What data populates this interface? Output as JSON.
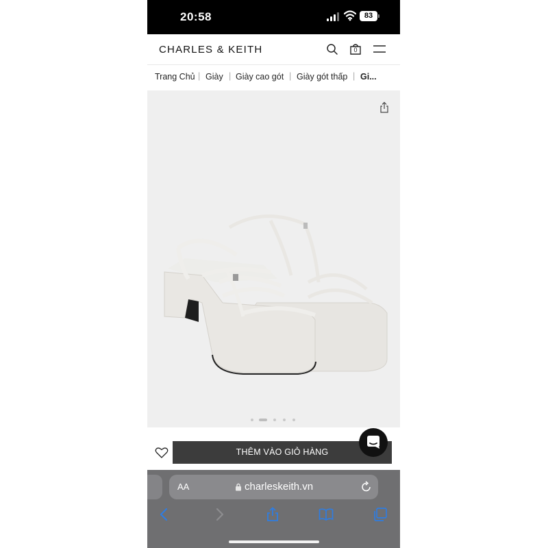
{
  "status_bar": {
    "time": "20:58",
    "battery": "83"
  },
  "header": {
    "brand": "CHARLES & KEITH",
    "cart_count": "0"
  },
  "breadcrumb": [
    "Trang Chủ",
    "Giày",
    "Giày cao gót",
    "Giày gót thấp",
    "Gi..."
  ],
  "product": {
    "image_count": 5,
    "active_image_index": 1
  },
  "actions": {
    "add_to_cart_label": "THÊM VÀO GIỎ HÀNG"
  },
  "browser": {
    "text_size_label": "AA",
    "url": "charleskeith.vn"
  },
  "colors": {
    "status_bar": "#000000",
    "image_bg": "#efefef",
    "cart_button": "#3c3c3c",
    "safari_bar": "#6f6f71",
    "safari_accent": "#2f7de1"
  }
}
